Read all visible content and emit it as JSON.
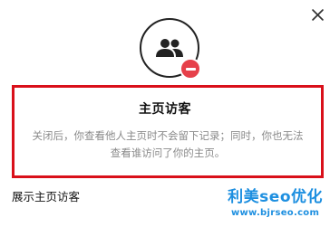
{
  "dialog": {
    "close_icon": "close-icon",
    "hero_icon": "people-icon",
    "badge_icon": "minus-circle-icon",
    "title": "主页访客",
    "description_line1": "关闭后，你查看他人主页时不会留下记录；同时，你也无法",
    "description_line2": "查看谁访问了你的主页。"
  },
  "setting": {
    "label": "展示主页访客"
  },
  "watermark": {
    "main": "利美seo优化",
    "url": "www.bjrseo.com"
  },
  "colors": {
    "badge_red": "#e6404a",
    "highlight_red": "#d9101a",
    "watermark_blue": "#1d8fe0"
  }
}
